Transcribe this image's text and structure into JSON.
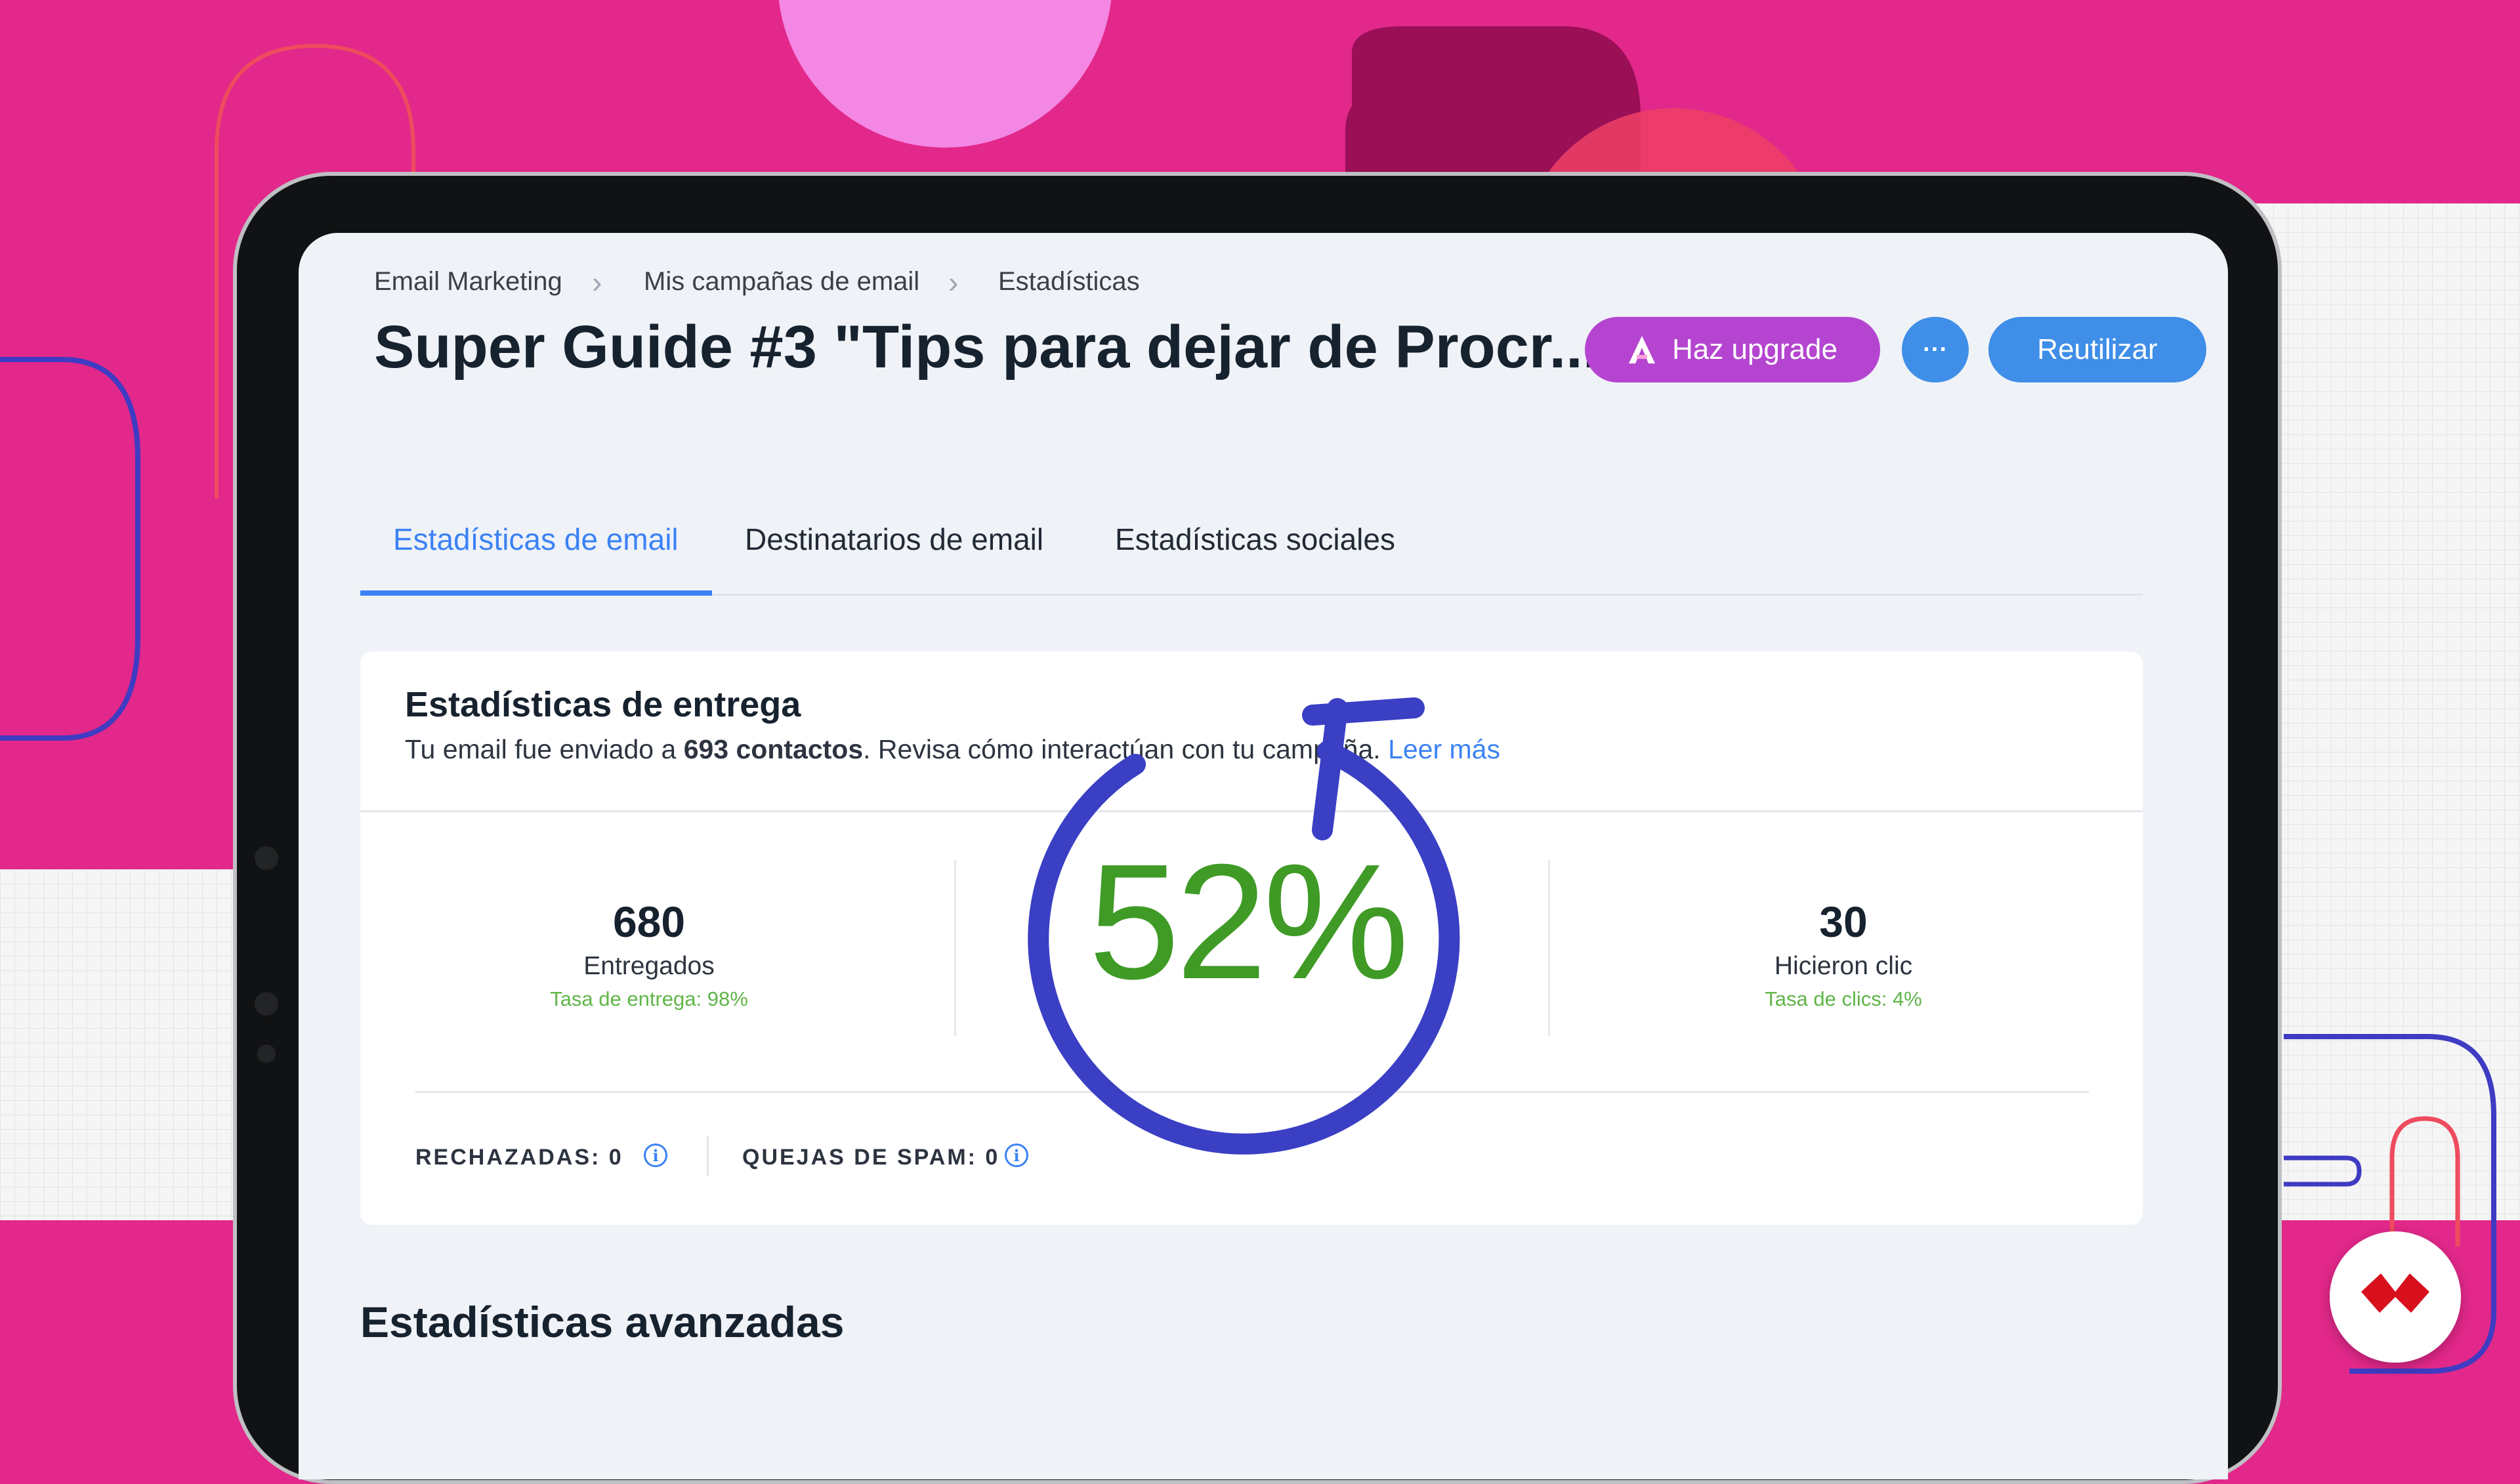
{
  "breadcrumb": [
    "Email Marketing",
    "Mis campañas de email",
    "Estadísticas"
  ],
  "page_title": "Super Guide #3 \"Tips para dejar de Procr...",
  "actions": {
    "upgrade_label": "Haz upgrade",
    "more_label": "···",
    "reuse_label": "Reutilizar"
  },
  "tabs": [
    "Estadísticas de email",
    "Destinatarios de email",
    "Estadísticas sociales"
  ],
  "delivery": {
    "title": "Estadísticas de entrega",
    "subtitle_pre": "Tu email fue enviado a ",
    "subtitle_bold": "693 contactos",
    "subtitle_post": ". Revisa cómo interactúan con tu campaña. ",
    "read_more": "Leer más",
    "delivered_value": "680",
    "delivered_label": "Entregados",
    "delivered_rate": "Tasa de entrega: 98%",
    "clicks_value": "30",
    "clicks_label": "Hicieron clic",
    "clicks_rate": "Tasa de clics: 4%",
    "rejected": "RECHAZADAS: 0",
    "spam": "QUEJAS DE SPAM: 0"
  },
  "overlay_percent": "52%",
  "advanced_title": "Estadísticas avanzadas",
  "colors": {
    "background": "#e2288a",
    "accent_blue": "#3b82f6",
    "upgrade_purple": "#b545d0",
    "overlay_ring": "#3a3fc4",
    "overlay_text": "#3f9a26"
  },
  "icons": [
    "chevron-right-icon",
    "upgrade-icon",
    "info-icon",
    "brand-logo-icon"
  ]
}
